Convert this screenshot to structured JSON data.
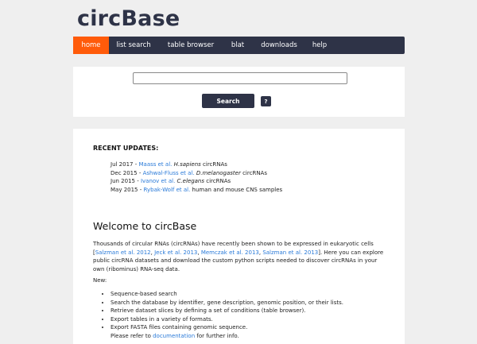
{
  "app": {
    "title": "circBase"
  },
  "nav": {
    "items": [
      {
        "label": "home",
        "active": true
      },
      {
        "label": "list search"
      },
      {
        "label": "table browser"
      },
      {
        "label": "blat"
      },
      {
        "label": "downloads"
      },
      {
        "label": "help"
      }
    ]
  },
  "search": {
    "input_value": "",
    "button_label": "Search",
    "help_label": "?"
  },
  "updates": {
    "heading": "RECENT UPDATES:",
    "items": [
      {
        "date": "Jul 2017",
        "sep": " - ",
        "link": "Maass et al.",
        "species": "H.sapiens",
        "text": " circRNAs"
      },
      {
        "date": "Dec 2015",
        "sep": " - ",
        "link": "Ashwal-Fluss et al.",
        "species": "D.melanogaster",
        "text": " circRNAs"
      },
      {
        "date": "Jun 2015",
        "sep": " - ",
        "link": "Ivanov et al.",
        "species": "C.elegans",
        "text": " circRNAs"
      },
      {
        "date": "May 2015",
        "sep": " - ",
        "link": "Rybak-Wolf et al.",
        "species": "",
        "text": " human and mouse CNS samples"
      }
    ]
  },
  "welcome": {
    "heading": "Welcome to circBase",
    "intro": {
      "p1": "Thousands of circular RNAs (circRNAs) have recently been shown to be expressed in eukaryotic cells [",
      "link1": "Salzman et al. 2012",
      "c1": ", ",
      "link2": "Jeck et al. 2013",
      "c2": ", ",
      "link3": "Memczak et al. 2013",
      "c3": ", ",
      "link4": "Salzman et al. 2013",
      "p2": "]. Here you can explore public circRNA datasets and download the custom python scripts needed to discover circRNAs in your own (ribominus) RNA-seq data."
    },
    "new_label": "New:",
    "features": [
      "Sequence-based search",
      "Search the database by identifier, gene description, genomic position, or their lists.",
      "Retrieve dataset slices by defining a set of conditions (table browser).",
      "Export tables in a variety of formats.",
      "Export FASTA files containing genomic sequence."
    ],
    "note_prefix": "Please refer to ",
    "note_link": "documentation",
    "note_suffix": " for further info."
  }
}
